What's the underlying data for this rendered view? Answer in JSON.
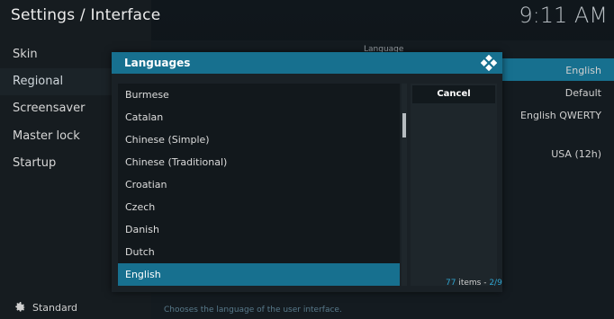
{
  "header": {
    "title": "Settings / Interface",
    "clock": "9:11 AM"
  },
  "sidebar": {
    "items": [
      {
        "label": "Skin"
      },
      {
        "label": "Regional"
      },
      {
        "label": "Screensaver"
      },
      {
        "label": "Master lock"
      },
      {
        "label": "Startup"
      }
    ],
    "profile_label": "Standard"
  },
  "content": {
    "section_label": "Language",
    "rows": [
      {
        "value": "English"
      },
      {
        "value": "Default"
      },
      {
        "value": "English QWERTY"
      },
      {
        "value": "USA (12h)"
      }
    ],
    "description": "Chooses the language of the user interface."
  },
  "dialog": {
    "title": "Languages",
    "items": [
      {
        "label": "Burmese"
      },
      {
        "label": "Catalan"
      },
      {
        "label": "Chinese (Simple)"
      },
      {
        "label": "Chinese (Traditional)"
      },
      {
        "label": "Croatian"
      },
      {
        "label": "Czech"
      },
      {
        "label": "Danish"
      },
      {
        "label": "Dutch"
      },
      {
        "label": "English"
      }
    ],
    "selected_index": 8,
    "cancel_label": "Cancel",
    "count_num": "77",
    "count_text": " items - ",
    "page_num": "2/9"
  },
  "colors": {
    "accent": "#17708f",
    "count_accent": "#2fa4d0"
  }
}
